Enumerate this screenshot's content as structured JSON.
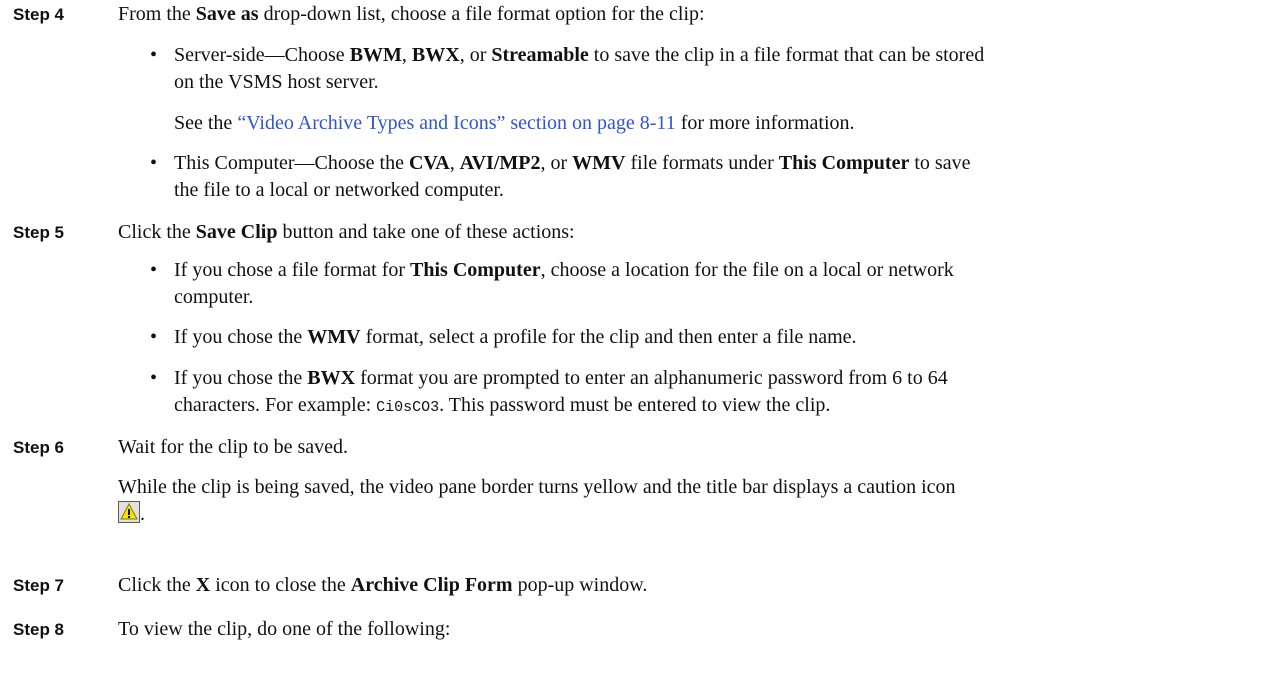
{
  "steps": [
    {
      "label": "Step 4",
      "line": {
        "t1": "From the ",
        "b1": "Save as",
        "t2": " drop-down list, choose a file format option for the clip:"
      },
      "bullets": [
        {
          "t1": "Server-side—Choose ",
          "b1": "BWM",
          "t2": ", ",
          "b2": "BWX",
          "t3": ", or ",
          "b3": "Streamable",
          "t4": " to save the clip in a file format that can be stored",
          "line2": "on the VSMS host server."
        },
        {
          "t1": "This Computer—Choose the ",
          "b1": "CVA",
          "t2": ", ",
          "b2": "AVI/MP2",
          "t3": ", or ",
          "b3": "WMV",
          "t4": " file formats under ",
          "b4": "This Computer",
          "t5": " to save",
          "line2": "the file to a local or networked computer."
        }
      ],
      "see_also": {
        "t1": "See the ",
        "link": "“Video Archive Types and Icons” section on page 8-11",
        "t2": " for more information."
      }
    },
    {
      "label": "Step 5",
      "line": {
        "t1": "Click the ",
        "b1": "Save Clip",
        "t2": " button and take one of these actions:"
      },
      "bullets": [
        {
          "t1": "If you chose a file format for ",
          "b1": "This Computer",
          "t2": ", choose a location for the file on a local or network",
          "line2": "computer."
        },
        {
          "t1": "If you chose the ",
          "b1": "WMV",
          "t2": " format, select a profile for the clip and then enter a file name."
        },
        {
          "t1": "If you chose the ",
          "b1": "BWX",
          "t2": " format you are prompted to enter an alphanumeric password from 6 to 64",
          "line2a": "characters. For example: ",
          "code": "Ci0sCO3",
          "line2b": ". This password must be entered to view the clip."
        }
      ]
    },
    {
      "label": "Step 6",
      "line": "Wait for the clip to be saved.",
      "para": "While the clip is being saved, the video pane border turns yellow and the title bar displays a caution icon",
      "para_end": "."
    },
    {
      "label": "Step 7",
      "line": {
        "t1": "Click the ",
        "b1": "X",
        "t2": " icon to close the ",
        "b2": "Archive Clip Form",
        "t3": " pop-up window."
      }
    },
    {
      "label": "Step 8",
      "line": "To view the clip, do one of the following:"
    }
  ],
  "bullet_glyph": "•",
  "colors": {
    "link": "#2f55d4",
    "caution_yellow": "#f5e400",
    "caution_icon_bg": "#e0e0e0"
  },
  "icons": {
    "caution": "caution-icon"
  }
}
